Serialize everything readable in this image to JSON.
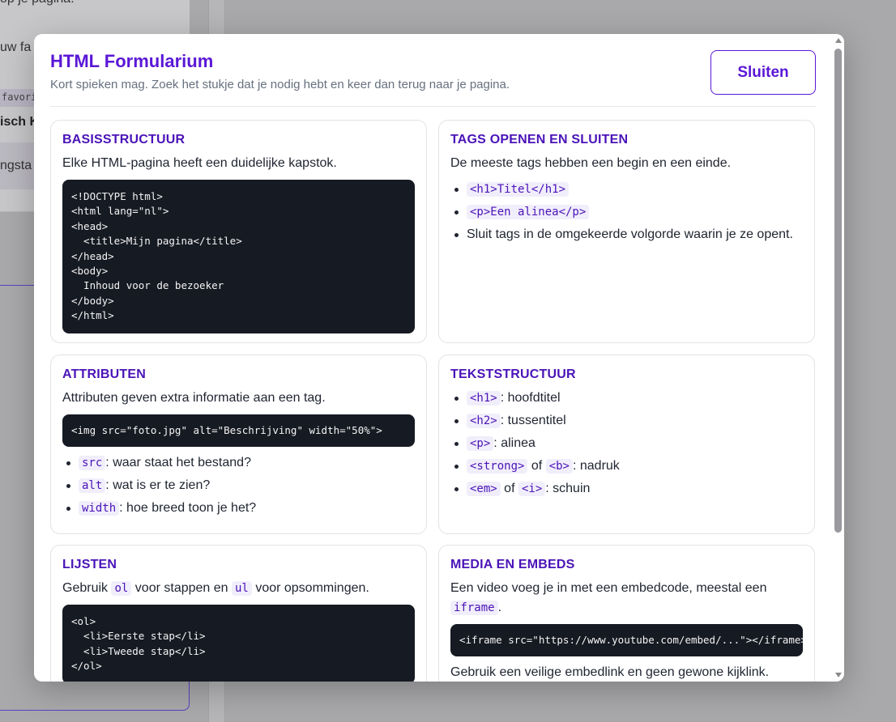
{
  "background": {
    "line1": "op je pagina.",
    "line2": "uw fa",
    "tag": "favorie",
    "bold": "isch K",
    "strip": "ngsta"
  },
  "modal": {
    "title": "HTML Formularium",
    "subtitle": "Kort spieken mag. Zoek het stukje dat je nodig hebt en keer dan terug naar je pagina.",
    "close_label": "Sluiten"
  },
  "cards": {
    "basis": {
      "title": "Basisstructuur",
      "text": "Elke HTML-pagina heeft een duidelijke kapstok.",
      "code": "<!DOCTYPE html>\n<html lang=\"nl\">\n<head>\n  <title>Mijn pagina</title>\n</head>\n<body>\n  Inhoud voor de bezoeker\n</body>\n</html>"
    },
    "tags": {
      "title": "Tags openen en sluiten",
      "text": "De meeste tags hebben een begin en een einde.",
      "item1": "<h1>Titel</h1>",
      "item2": "<p>Een alinea</p>",
      "item3": "Sluit tags in de omgekeerde volgorde waarin je ze opent."
    },
    "attr": {
      "title": "Attributen",
      "text": "Attributen geven extra informatie aan een tag.",
      "code": "<img src=\"foto.jpg\" alt=\"Beschrijving\" width=\"50%\">",
      "items": [
        {
          "code": "src",
          "text": ": waar staat het bestand?"
        },
        {
          "code": "alt",
          "text": ": wat is er te zien?"
        },
        {
          "code": "width",
          "text": ": hoe breed toon je het?"
        }
      ]
    },
    "tekst": {
      "title": "Tekststructuur",
      "items": [
        {
          "code": "<h1>",
          "text": ": hoofdtitel"
        },
        {
          "code": "<h2>",
          "text": ": tussentitel"
        },
        {
          "code": "<p>",
          "text": ": alinea"
        },
        {
          "code": "<strong>",
          "mid": "of",
          "code2": "<b>",
          "text": ": nadruk"
        },
        {
          "code": "<em>",
          "mid": "of",
          "code2": "<i>",
          "text": ": schuin"
        }
      ]
    },
    "lijsten": {
      "title": "Lijsten",
      "text_a": "Gebruik",
      "code_a": "ol",
      "text_b": "voor stappen en",
      "code_b": "ul",
      "text_c": "voor opsommingen.",
      "code": "<ol>\n  <li>Eerste stap</li>\n  <li>Tweede stap</li>\n</ol>"
    },
    "media": {
      "title": "Media en embeds",
      "text_a": "Een video voeg je in met een embedcode, meestal een",
      "code_a": "iframe",
      "text_b": ".",
      "code": "<iframe src=\"https://www.youtube.com/embed/...\"></iframe>",
      "text2": "Gebruik een veilige embedlink en geen gewone kijklink."
    }
  },
  "colors": {
    "accent": "#5a17d6",
    "heading": "#4a13b8",
    "code_bg": "#161a22",
    "overlay": "#a9a9ab"
  }
}
